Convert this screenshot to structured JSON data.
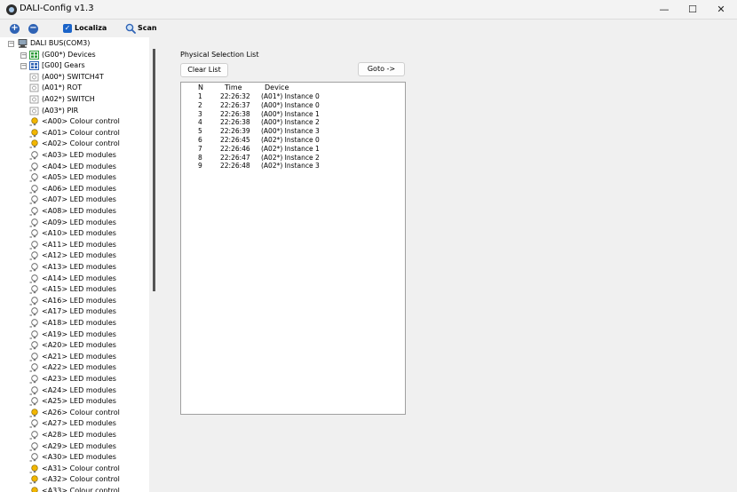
{
  "window": {
    "title": "DALI-Config v1.3",
    "minimize_glyph": "—",
    "maximize_glyph": "☐",
    "close_glyph": "✕"
  },
  "toolbar": {
    "add_icon": "add-icon",
    "remove_icon": "remove-icon",
    "localiza_label": "Localiza",
    "localiza_checked": true,
    "scan_label": "Scan"
  },
  "tree": {
    "root": "DALI BUS(COM3)",
    "groups": [
      {
        "label": "(G00*) Devices",
        "icon": "devices-group-icon"
      },
      {
        "label": "[G00] Gears",
        "icon": "gears-group-icon"
      }
    ],
    "devices": [
      {
        "label": "(A00*) SWITCH4T",
        "icon": "switch4t-icon"
      },
      {
        "label": "(A01*) ROT",
        "icon": "rotary-icon"
      },
      {
        "label": "(A02*) SWITCH",
        "icon": "switch-icon"
      },
      {
        "label": "(A03*) PIR",
        "icon": "pir-sensor-icon"
      }
    ],
    "gears": [
      {
        "label": "<A00> Colour control",
        "kind": "colour"
      },
      {
        "label": "<A01> Colour control",
        "kind": "colour"
      },
      {
        "label": "<A02> Colour control",
        "kind": "colour"
      },
      {
        "label": "<A03> LED modules",
        "kind": "led"
      },
      {
        "label": "<A04> LED modules",
        "kind": "led"
      },
      {
        "label": "<A05> LED modules",
        "kind": "led"
      },
      {
        "label": "<A06> LED modules",
        "kind": "led"
      },
      {
        "label": "<A07> LED modules",
        "kind": "led"
      },
      {
        "label": "<A08> LED modules",
        "kind": "led"
      },
      {
        "label": "<A09> LED modules",
        "kind": "led"
      },
      {
        "label": "<A10> LED modules",
        "kind": "led"
      },
      {
        "label": "<A11> LED modules",
        "kind": "led"
      },
      {
        "label": "<A12> LED modules",
        "kind": "led"
      },
      {
        "label": "<A13> LED modules",
        "kind": "led"
      },
      {
        "label": "<A14> LED modules",
        "kind": "led"
      },
      {
        "label": "<A15> LED modules",
        "kind": "led"
      },
      {
        "label": "<A16> LED modules",
        "kind": "led"
      },
      {
        "label": "<A17> LED modules",
        "kind": "led"
      },
      {
        "label": "<A18> LED modules",
        "kind": "led"
      },
      {
        "label": "<A19> LED modules",
        "kind": "led"
      },
      {
        "label": "<A20> LED modules",
        "kind": "led"
      },
      {
        "label": "<A21> LED modules",
        "kind": "led"
      },
      {
        "label": "<A22> LED modules",
        "kind": "led"
      },
      {
        "label": "<A23> LED modules",
        "kind": "led"
      },
      {
        "label": "<A24> LED modules",
        "kind": "led"
      },
      {
        "label": "<A25> LED modules",
        "kind": "led"
      },
      {
        "label": "<A26> Colour control",
        "kind": "colour"
      },
      {
        "label": "<A27> LED modules",
        "kind": "led"
      },
      {
        "label": "<A28> LED modules",
        "kind": "led"
      },
      {
        "label": "<A29> LED modules",
        "kind": "led"
      },
      {
        "label": "<A30> LED modules",
        "kind": "led"
      },
      {
        "label": "<A31> Colour control",
        "kind": "colour"
      },
      {
        "label": "<A32> Colour control",
        "kind": "colour"
      },
      {
        "label": "<A33> Colour control",
        "kind": "colour"
      }
    ]
  },
  "panel": {
    "section_label": "Physical Selection List",
    "clear_button": "Clear List",
    "goto_button": "Goto ->",
    "columns": [
      "N",
      "Time",
      "Device"
    ],
    "rows": [
      {
        "n": "1",
        "time": "22:26:32",
        "device": "(A01*) Instance 0"
      },
      {
        "n": "2",
        "time": "22:26:37",
        "device": "(A00*) Instance 0"
      },
      {
        "n": "3",
        "time": "22:26:38",
        "device": "(A00*) Instance 1"
      },
      {
        "n": "4",
        "time": "22:26:38",
        "device": "(A00*) Instance 2"
      },
      {
        "n": "5",
        "time": "22:26:39",
        "device": "(A00*) Instance 3"
      },
      {
        "n": "6",
        "time": "22:26:45",
        "device": "(A02*) Instance 0"
      },
      {
        "n": "7",
        "time": "22:26:46",
        "device": "(A02*) Instance 1"
      },
      {
        "n": "8",
        "time": "22:26:47",
        "device": "(A02*) Instance 2"
      },
      {
        "n": "9",
        "time": "22:26:48",
        "device": "(A02*) Instance 3"
      }
    ]
  },
  "colors": {
    "accent": "#1a63c8",
    "bulb": "#f2b600",
    "tree_icon_green": "#2e9d3a",
    "tree_icon_blue": "#2f63b5"
  }
}
